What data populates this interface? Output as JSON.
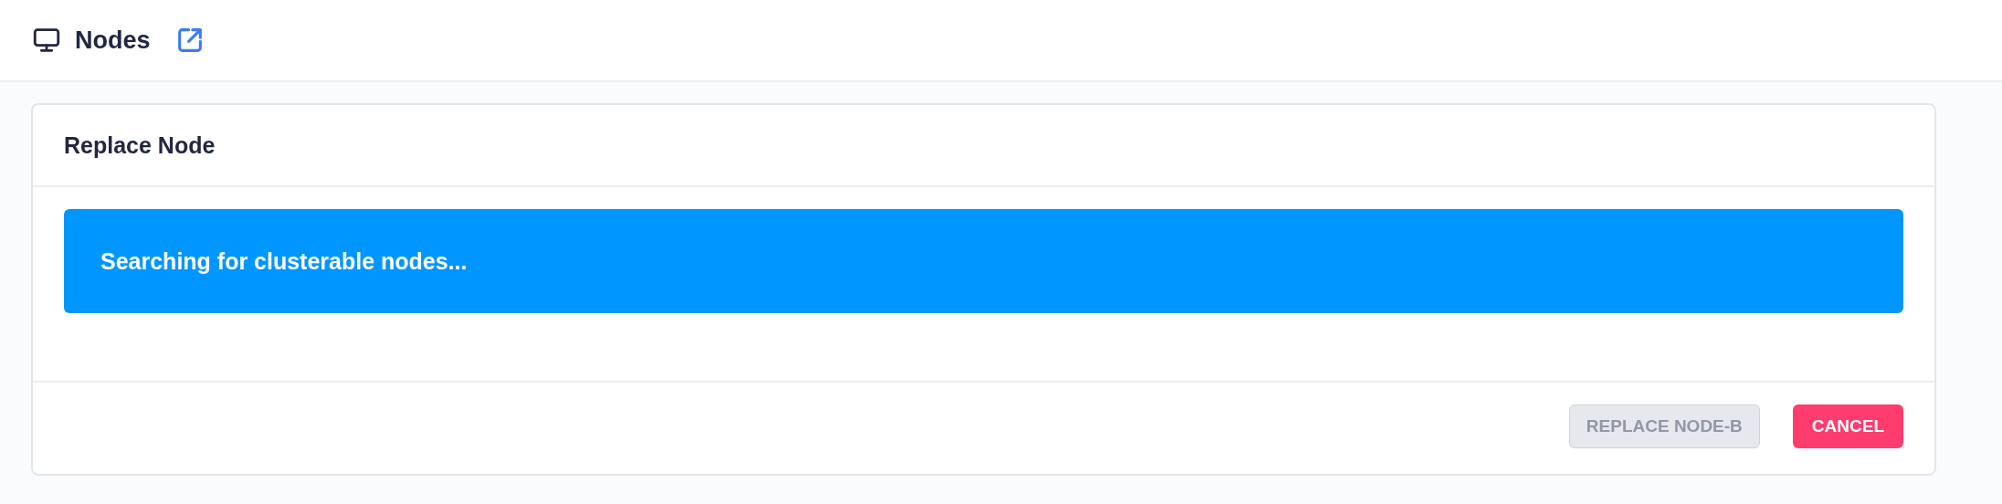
{
  "header": {
    "title": "Nodes"
  },
  "card": {
    "title": "Replace Node",
    "alert": {
      "text": "Searching for clusterable nodes..."
    },
    "buttons": [
      {
        "label": "REPLACE NODE-B",
        "kind": "secondary",
        "disabled": true
      },
      {
        "label": "CANCEL",
        "kind": "danger",
        "disabled": false
      }
    ]
  }
}
